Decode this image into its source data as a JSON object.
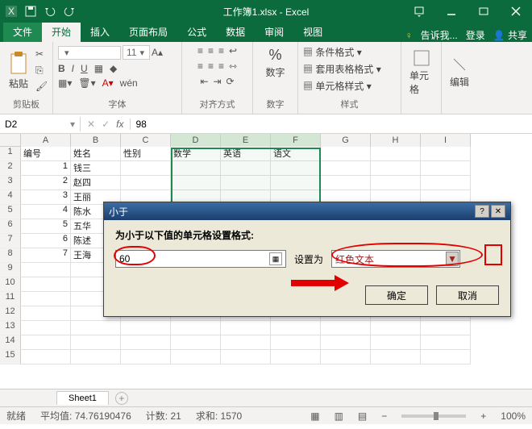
{
  "titlebar": {
    "title": "工作簿1.xlsx - Excel"
  },
  "tabs": {
    "file": "文件",
    "home": "开始",
    "insert": "插入",
    "layout": "页面布局",
    "formulas": "公式",
    "data": "数据",
    "review": "审阅",
    "view": "视图",
    "tell_me": "告诉我...",
    "signin": "登录",
    "share": "共享"
  },
  "ribbon": {
    "clipboard": {
      "paste": "粘贴",
      "label": "剪贴板"
    },
    "font": {
      "size": "11",
      "label": "字体",
      "wen": "wén"
    },
    "align": {
      "label": "对齐方式"
    },
    "number": {
      "percent": "%",
      "btn": "数字",
      "label": "数字"
    },
    "styles": {
      "cond": "条件格式",
      "table": "套用表格格式",
      "cell": "单元格样式",
      "label": "样式"
    },
    "cells": {
      "btn": "单元格"
    },
    "editing": {
      "btn": "编辑"
    }
  },
  "namebox": "D2",
  "formula": "98",
  "columns": [
    "A",
    "B",
    "C",
    "D",
    "E",
    "F",
    "G",
    "H",
    "I"
  ],
  "rows": [
    {
      "n": "1",
      "c": [
        "编号",
        "姓名",
        "性别",
        "数学",
        "英语",
        "语文",
        "",
        "",
        ""
      ]
    },
    {
      "n": "2",
      "c": [
        "1",
        "钱三",
        "",
        "",
        "",
        "",
        "",
        "",
        ""
      ]
    },
    {
      "n": "3",
      "c": [
        "2",
        "赵四",
        "",
        "",
        "",
        "",
        "",
        "",
        ""
      ]
    },
    {
      "n": "4",
      "c": [
        "3",
        "王丽",
        "",
        "",
        "",
        "",
        "",
        "",
        ""
      ]
    },
    {
      "n": "5",
      "c": [
        "4",
        "陈水",
        "",
        "",
        "",
        "",
        "",
        "",
        ""
      ]
    },
    {
      "n": "6",
      "c": [
        "5",
        "五华",
        "",
        "",
        "",
        "",
        "",
        "",
        ""
      ]
    },
    {
      "n": "7",
      "c": [
        "6",
        "陈述",
        "",
        "",
        "",
        "",
        "",
        "",
        ""
      ]
    },
    {
      "n": "8",
      "c": [
        "7",
        "王海",
        "",
        "",
        "",
        "",
        "",
        "",
        ""
      ]
    },
    {
      "n": "9",
      "c": [
        "",
        "",
        "",
        "",
        "",
        "",
        "",
        "",
        ""
      ]
    },
    {
      "n": "10",
      "c": [
        "",
        "",
        "",
        "",
        "",
        "",
        "",
        "",
        ""
      ]
    },
    {
      "n": "11",
      "c": [
        "",
        "",
        "",
        "",
        "",
        "",
        "",
        "",
        ""
      ]
    },
    {
      "n": "12",
      "c": [
        "",
        "",
        "",
        "",
        "",
        "",
        "",
        "",
        ""
      ]
    },
    {
      "n": "13",
      "c": [
        "",
        "",
        "",
        "",
        "",
        "",
        "",
        "",
        ""
      ]
    },
    {
      "n": "14",
      "c": [
        "",
        "",
        "",
        "",
        "",
        "",
        "",
        "",
        ""
      ]
    },
    {
      "n": "15",
      "c": [
        "",
        "",
        "",
        "",
        "",
        "",
        "",
        "",
        ""
      ]
    }
  ],
  "sheet": {
    "name": "Sheet1"
  },
  "status": {
    "ready": "就绪",
    "avg_l": "平均值:",
    "avg": "74.76190476",
    "count_l": "计数:",
    "count": "21",
    "sum_l": "求和:",
    "sum": "1570",
    "zoom": "100%"
  },
  "dialog": {
    "title": "小于",
    "label": "为小于以下值的单元格设置格式:",
    "value": "60",
    "set_label": "设置为",
    "format": "红色文本",
    "ok": "确定",
    "cancel": "取消"
  }
}
